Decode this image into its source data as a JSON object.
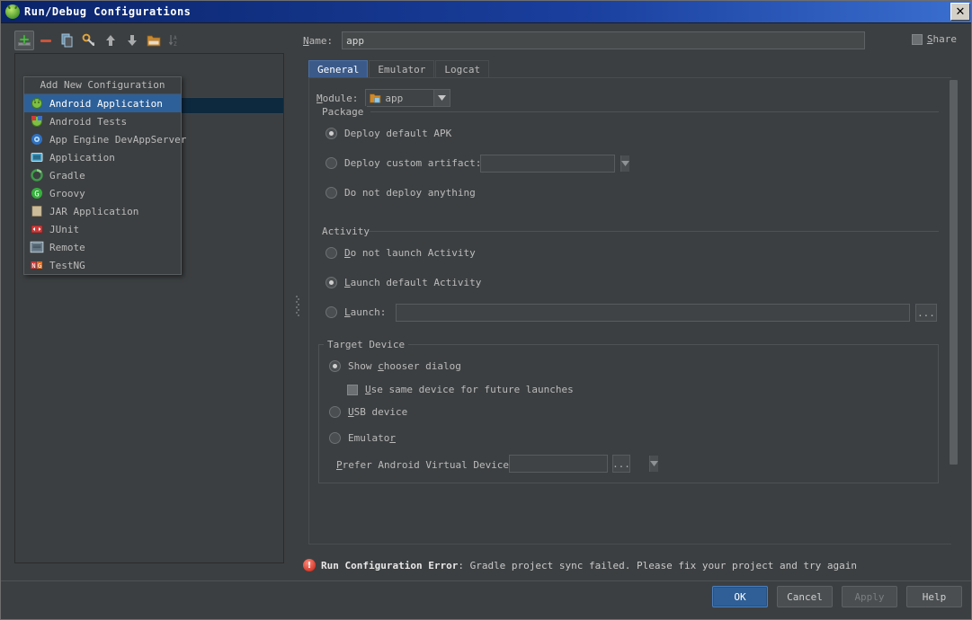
{
  "window": {
    "title": "Run/Debug Configurations",
    "title_icon": "android-icon",
    "close_label": "✕"
  },
  "left_toolbar": {
    "buttons": [
      {
        "name": "add-configuration-button",
        "icon": "plus-icon",
        "label": "+"
      },
      {
        "name": "remove-configuration-button",
        "icon": "minus-icon",
        "label": "−"
      },
      {
        "name": "copy-configuration-button",
        "icon": "copy-icon",
        "label": "copy"
      },
      {
        "name": "edit-templates-button",
        "icon": "wrench-icon",
        "label": "templates"
      },
      {
        "name": "move-up-button",
        "icon": "arrow-up-icon",
        "label": "up"
      },
      {
        "name": "move-down-button",
        "icon": "arrow-down-icon",
        "label": "down"
      },
      {
        "name": "create-folder-button",
        "icon": "folder-icon",
        "label": "folder"
      },
      {
        "name": "sort-configurations-button",
        "icon": "sort-az-icon",
        "label": "sort"
      }
    ]
  },
  "add_popup": {
    "title": "Add New Configuration",
    "items": [
      {
        "label": "Android Application",
        "icon": "android-green-icon",
        "selected": true
      },
      {
        "label": "Android Tests",
        "icon": "android-test-icon",
        "selected": false
      },
      {
        "label": "App Engine DevAppServer",
        "icon": "app-engine-icon",
        "selected": false
      },
      {
        "label": "Application",
        "icon": "application-icon",
        "selected": false
      },
      {
        "label": "Gradle",
        "icon": "gradle-icon",
        "selected": false
      },
      {
        "label": "Groovy",
        "icon": "groovy-icon",
        "selected": false
      },
      {
        "label": "JAR Application",
        "icon": "jar-icon",
        "selected": false
      },
      {
        "label": "JUnit",
        "icon": "junit-icon",
        "selected": false
      },
      {
        "label": "Remote",
        "icon": "remote-icon",
        "selected": false
      },
      {
        "label": "TestNG",
        "icon": "testng-icon",
        "selected": false
      }
    ]
  },
  "right_panel": {
    "name_label": "Name:",
    "name_value": "app",
    "share_label": "Share",
    "share_checked": false,
    "tabs": [
      {
        "label": "General",
        "active": true
      },
      {
        "label": "Emulator",
        "active": false
      },
      {
        "label": "Logcat",
        "active": false
      }
    ],
    "module": {
      "label": "Module:",
      "value": "app",
      "icon": "module-folder-icon"
    },
    "package_group": {
      "title": "Package",
      "options": [
        {
          "label": "Deploy default APK",
          "selected": true
        },
        {
          "label": "Deploy custom artifact:",
          "selected": false
        },
        {
          "label": "Do not deploy anything",
          "selected": false
        }
      ],
      "artifact_value": ""
    },
    "activity_group": {
      "title": "Activity",
      "options": [
        {
          "label": "Do not launch Activity",
          "selected": false
        },
        {
          "label": "Launch default Activity",
          "selected": true
        },
        {
          "label": "Launch:",
          "selected": false
        }
      ],
      "launch_value": "",
      "browse_label": "..."
    },
    "target_device_group": {
      "title": "Target Device",
      "options": [
        {
          "label": "Show chooser dialog",
          "selected": true
        },
        {
          "label": "USB device",
          "selected": false
        },
        {
          "label": "Emulator",
          "selected": false
        }
      ],
      "checkbox_label": "Use same device for future launches",
      "checkbox_checked": false,
      "avd_label": "Prefer Android Virtual Device:",
      "avd_value": "",
      "avd_browse_label": "..."
    }
  },
  "error": {
    "icon": "error-exclamation-icon",
    "icon_glyph": "!",
    "prefix": "Run Configuration Error",
    "message": ": Gradle project sync failed. Please fix your project and try again"
  },
  "dialog_buttons": [
    {
      "label": "OK",
      "name": "ok-button",
      "style": "primary",
      "enabled": true
    },
    {
      "label": "Cancel",
      "name": "cancel-button",
      "style": "normal",
      "enabled": true
    },
    {
      "label": "Apply",
      "name": "apply-button",
      "style": "disabled",
      "enabled": false
    },
    {
      "label": "Help",
      "name": "help-button",
      "style": "normal",
      "enabled": true
    }
  ],
  "colors": {
    "window_bg": "#3c3f41",
    "titlebar_start": "#0a246a",
    "accent_selection": "#2d6099",
    "tab_active": "#3b5a8a",
    "error_red": "#d33a2c",
    "text": "#bbbbbb"
  }
}
